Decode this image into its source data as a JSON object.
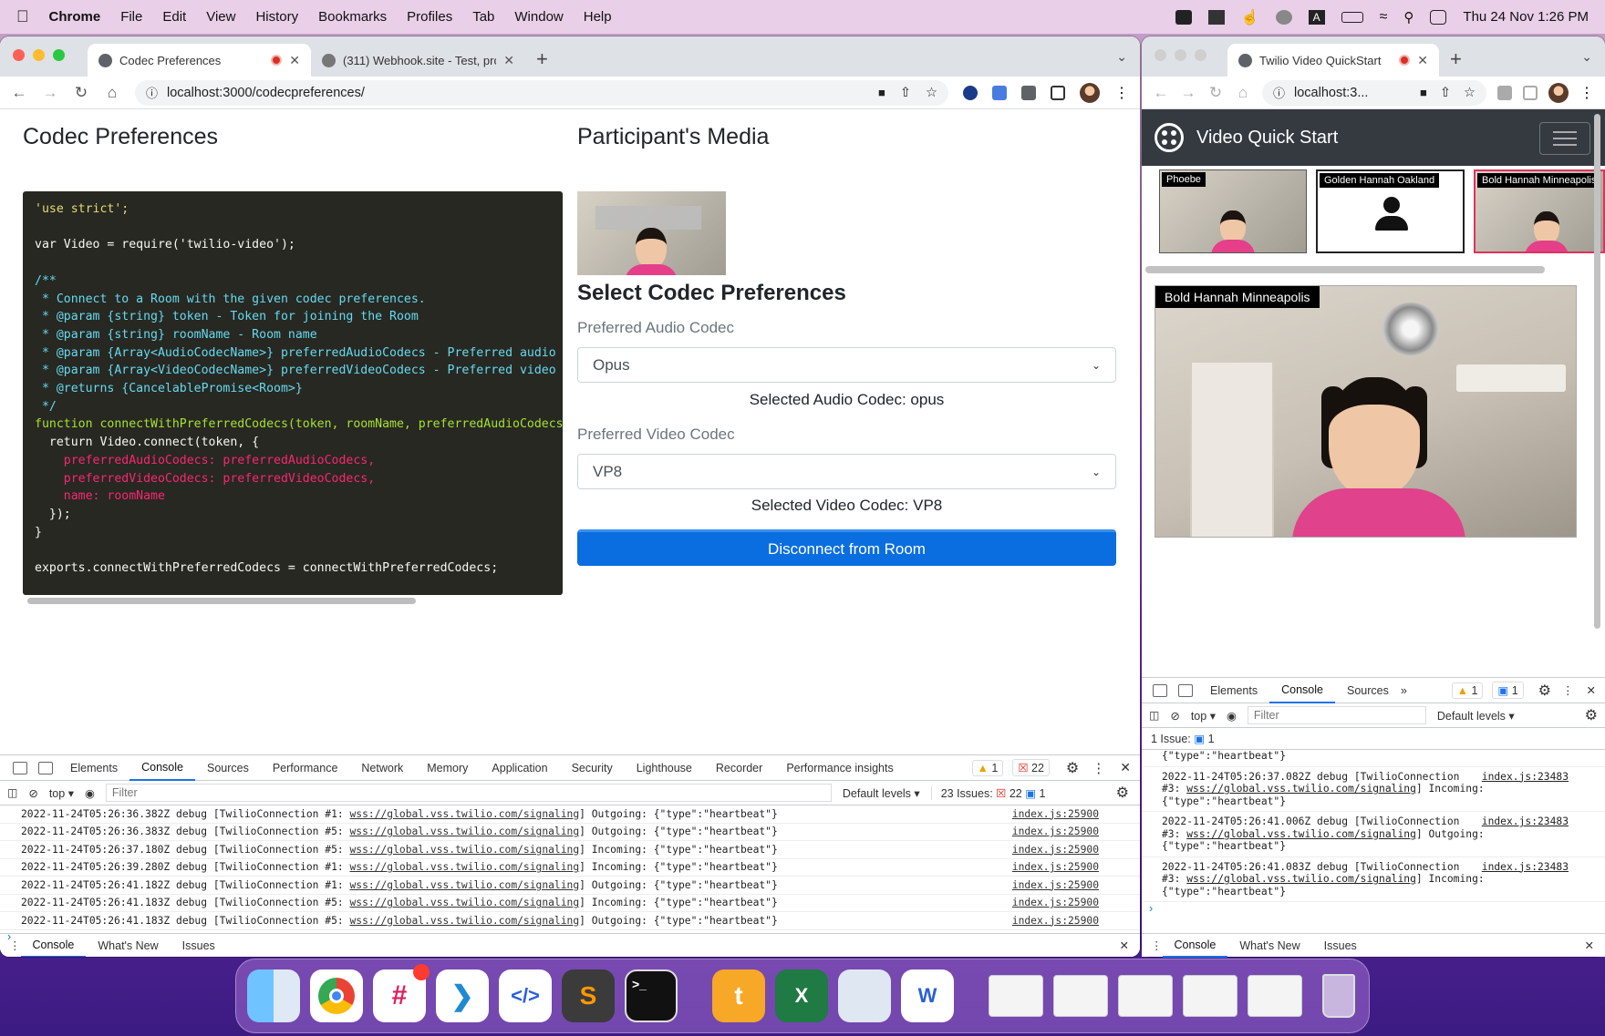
{
  "menubar": {
    "app": "Chrome",
    "items": [
      "File",
      "Edit",
      "View",
      "History",
      "Bookmarks",
      "Profiles",
      "Tab",
      "Window",
      "Help"
    ],
    "clock": "Thu 24 Nov  1:26 PM"
  },
  "left_window": {
    "tabs": [
      {
        "title": "Codec Preferences",
        "active": true
      },
      {
        "title": "(311) Webhook.site - Test, proc",
        "active": false
      }
    ],
    "url": "localhost:3000/codecpreferences/",
    "page": {
      "title": "Codec Preferences",
      "code_lines": [
        "'use strict';",
        "",
        "var Video = require('twilio-video');",
        "",
        "/**",
        " * Connect to a Room with the given codec preferences.",
        " * @param {string} token - Token for joining the Room",
        " * @param {string} roomName - Room name",
        " * @param {Array<AudioCodecName>} preferredAudioCodecs - Preferred audio",
        " * @param {Array<VideoCodecName>} preferredVideoCodecs - Preferred video",
        " * @returns {CancelablePromise<Room>}",
        " */",
        "function connectWithPreferredCodecs(token, roomName, preferredAudioCodecs",
        "  return Video.connect(token, {",
        "    preferredAudioCodecs: preferredAudioCodecs,",
        "    preferredVideoCodecs: preferredVideoCodecs,",
        "    name: roomName",
        "  });",
        "}",
        "",
        "exports.connectWithPreferredCodecs = connectWithPreferredCodecs;"
      ],
      "media_title": "Participant's Media",
      "select_title": "Select Codec Preferences",
      "audio_label": "Preferred Audio Codec",
      "audio_value": "Opus",
      "audio_selected": "Selected Audio Codec: opus",
      "video_label": "Preferred Video Codec",
      "video_value": "VP8",
      "video_selected": "Selected Video Codec: VP8",
      "disconnect_label": "Disconnect from Room"
    },
    "devtools": {
      "tabs": [
        "Elements",
        "Console",
        "Sources",
        "Performance",
        "Network",
        "Memory",
        "Application",
        "Security",
        "Lighthouse",
        "Recorder",
        "Performance insights"
      ],
      "active_tab": "Console",
      "warnings": "1",
      "errors": "22",
      "context": "top",
      "filter_placeholder": "Filter",
      "levels": "Default levels",
      "issues_label": "23 Issues:",
      "issues_errors": "22",
      "issues_info": "1",
      "logs": [
        {
          "ts": "2022-11-24T05:26:36.382Z debug [TwilioConnection #1: ",
          "url": "wss://global.vss.twilio.com/signaling",
          "msg": "] Outgoing: {\"type\":\"heartbeat\"}",
          "src": "index.js:25900"
        },
        {
          "ts": "2022-11-24T05:26:36.383Z debug [TwilioConnection #5: ",
          "url": "wss://global.vss.twilio.com/signaling",
          "msg": "] Outgoing: {\"type\":\"heartbeat\"}",
          "src": "index.js:25900"
        },
        {
          "ts": "2022-11-24T05:26:37.180Z debug [TwilioConnection #5: ",
          "url": "wss://global.vss.twilio.com/signaling",
          "msg": "] Incoming: {\"type\":\"heartbeat\"}",
          "src": "index.js:25900"
        },
        {
          "ts": "2022-11-24T05:26:39.280Z debug [TwilioConnection #1: ",
          "url": "wss://global.vss.twilio.com/signaling",
          "msg": "] Incoming: {\"type\":\"heartbeat\"}",
          "src": "index.js:25900"
        },
        {
          "ts": "2022-11-24T05:26:41.182Z debug [TwilioConnection #1: ",
          "url": "wss://global.vss.twilio.com/signaling",
          "msg": "] Outgoing: {\"type\":\"heartbeat\"}",
          "src": "index.js:25900"
        },
        {
          "ts": "2022-11-24T05:26:41.183Z debug [TwilioConnection #5: ",
          "url": "wss://global.vss.twilio.com/signaling",
          "msg": "] Incoming: {\"type\":\"heartbeat\"}",
          "src": "index.js:25900"
        },
        {
          "ts": "2022-11-24T05:26:41.183Z debug [TwilioConnection #5: ",
          "url": "wss://global.vss.twilio.com/signaling",
          "msg": "] Outgoing: {\"type\":\"heartbeat\"}",
          "src": "index.js:25900"
        }
      ],
      "drawer_tabs": [
        "Console",
        "What's New",
        "Issues"
      ]
    }
  },
  "right_window": {
    "tab_title": "Twilio Video QuickStart",
    "url": "localhost:3...",
    "app_title": "Video Quick Start",
    "participants": [
      "Phoebe",
      "Golden Hannah Oakland",
      "Bold Hannah Minneapolis"
    ],
    "main_participant": "Bold Hannah Minneapolis",
    "devtools": {
      "tabs": [
        "Elements",
        "Console",
        "Sources"
      ],
      "active_tab": "Console",
      "warnings": "1",
      "info": "1",
      "context": "top",
      "filter_placeholder": "Filter",
      "levels": "Default levels",
      "issues": "1 Issue:",
      "issues_count": "1",
      "top_fragment": "{\"type\":\"heartbeat\"}",
      "logs": [
        {
          "l1": "2022-11-24T05:26:37.082Z debug [TwilioConnection",
          "l2a": "#3: ",
          "url": "wss://global.vss.twilio.com/signaling",
          "l2b": "] Incoming:",
          "l3": "{\"type\":\"heartbeat\"}",
          "src": "index.js:23483"
        },
        {
          "l1": "2022-11-24T05:26:41.006Z debug [TwilioConnection",
          "l2a": "#3: ",
          "url": "wss://global.vss.twilio.com/signaling",
          "l2b": "] Outgoing:",
          "l3": "{\"type\":\"heartbeat\"}",
          "src": "index.js:23483"
        },
        {
          "l1": "2022-11-24T05:26:41.083Z debug [TwilioConnection",
          "l2a": "#3: ",
          "url": "wss://global.vss.twilio.com/signaling",
          "l2b": "] Incoming:",
          "l3": "{\"type\":\"heartbeat\"}",
          "src": "index.js:23483"
        }
      ],
      "drawer_tabs": [
        "Console",
        "What's New",
        "Issues"
      ]
    }
  },
  "dock": {
    "apps": [
      {
        "name": "finder-icon",
        "color": "#3fa0f0"
      },
      {
        "name": "chrome-icon",
        "color": "#ffffff"
      },
      {
        "name": "slack-icon",
        "color": "#ffffff"
      },
      {
        "name": "vscode-icon",
        "color": "#ffffff"
      },
      {
        "name": "code-editor-icon",
        "color": "#ffffff"
      },
      {
        "name": "sublime-icon",
        "color": "#3b3b3b"
      },
      {
        "name": "terminal-icon",
        "color": "#111111"
      },
      {
        "name": "toolbox-icon",
        "color": "#f7a826"
      },
      {
        "name": "excel-icon",
        "color": "#1f7a43"
      },
      {
        "name": "preview-icon",
        "color": "#dfe8f2"
      },
      {
        "name": "word-icon",
        "color": "#ffffff"
      }
    ]
  }
}
